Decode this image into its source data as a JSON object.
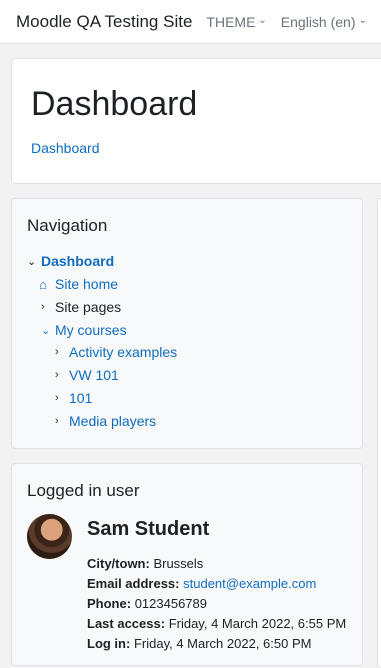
{
  "navbar": {
    "site_name": "Moodle QA Testing Site",
    "theme_menu": "THEME",
    "language_menu": "English (en)"
  },
  "header": {
    "title": "Dashboard",
    "breadcrumb": "Dashboard"
  },
  "navigation": {
    "title": "Navigation",
    "items": [
      {
        "label": "Dashboard"
      },
      {
        "label": "Site home"
      },
      {
        "label": "Site pages"
      },
      {
        "label": "My courses"
      },
      {
        "label": "Activity examples"
      },
      {
        "label": "VW 101"
      },
      {
        "label": "101"
      },
      {
        "label": "Media players"
      }
    ]
  },
  "logged_in": {
    "title": "Logged in user",
    "name": "Sam Student",
    "city_label": "City/town:",
    "city": "Brussels",
    "email_label": "Email address:",
    "email": "student@example.com",
    "phone_label": "Phone:",
    "phone": "0123456789",
    "last_access_label": "Last access:",
    "last_access": "Friday, 4 March 2022, 6:55 PM",
    "login_label": "Log in:",
    "login": "Friday, 4 March 2022, 6:50 PM"
  },
  "colors": {
    "link": "#0f6cbf",
    "text": "#1d2125",
    "block_bg": "#f8f9fa"
  }
}
